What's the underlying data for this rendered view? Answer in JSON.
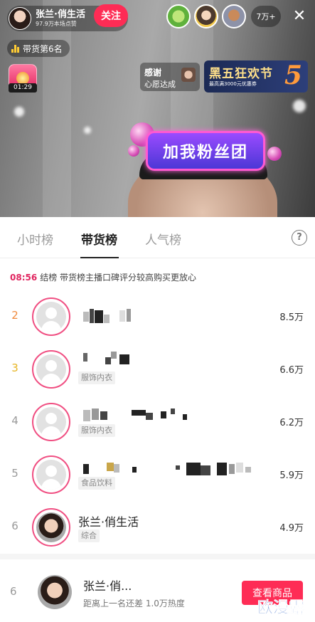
{
  "live": {
    "anchor_name": "张兰·俏生活",
    "likes_text": "97.9万本场点赞",
    "follow_label": "关注",
    "viewer_count": "7万+",
    "close_glyph": "✕",
    "rank_badge": "带货第6名",
    "timer": "01:29",
    "thanks_title": "感谢",
    "thanks_sub": "心愿达成",
    "promo_big": "黑五狂欢节",
    "promo_small": "最高满3000元优惠券",
    "promo_number": "5",
    "fan_sticker": "加我粉丝团"
  },
  "tabs": [
    {
      "label": "小时榜",
      "active": false
    },
    {
      "label": "带货榜",
      "active": true
    },
    {
      "label": "人气榜",
      "active": false
    }
  ],
  "help_glyph": "?",
  "settle": {
    "time": "08:56",
    "text": "结榜  带货榜主播口碑评分较高购买更放心"
  },
  "rows": [
    {
      "rank": "2",
      "name": "",
      "tag": "",
      "value": "8.5万"
    },
    {
      "rank": "3",
      "name": "",
      "tag": "服饰内衣",
      "value": "6.6万"
    },
    {
      "rank": "4",
      "name": "",
      "tag": "服饰内衣",
      "value": "6.2万"
    },
    {
      "rank": "5",
      "name": "",
      "tag": "食品饮料",
      "value": "5.9万"
    },
    {
      "rank": "6",
      "name": "张兰·俏生活",
      "tag": "综合",
      "value": "4.9万"
    }
  ],
  "own": {
    "rank": "6",
    "name": "张兰·俏...",
    "gap_text": "距离上一名还差 1.0万热度",
    "button_label": "查看商品"
  },
  "watermark": "欧漫露",
  "colors": {
    "accent": "#fe2c55",
    "rank2": "#f08a3c",
    "rank3": "#e6b422",
    "avatar_ring": "#f04f82"
  }
}
